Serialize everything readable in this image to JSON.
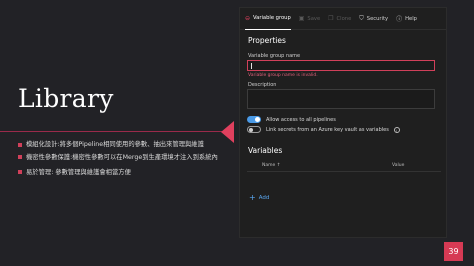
{
  "slide": {
    "title": "Library",
    "bullets": [
      "模組化設計:將多個Pipeline相同使用的參數、抽出來管理與維護",
      "機密性參數保護:機密性參數可以在Merge到生產環境才注入到系統內",
      "易於管理: 參數管理與維護會相當方便"
    ],
    "page_number": "39",
    "accent_color": "#d63a54"
  },
  "toolbar": {
    "variable_group": "Variable group",
    "save": "Save",
    "clone": "Clone",
    "security": "Security",
    "help": "Help"
  },
  "properties": {
    "title": "Properties",
    "name_label": "Variable group name",
    "name_value": "",
    "name_error": "Variable group name is invalid.",
    "description_label": "Description",
    "description_value": "",
    "allow_pipelines_label": "Allow access to all pipelines",
    "link_keyvault_label": "Link secrets from an Azure key vault as variables"
  },
  "variables": {
    "title": "Variables",
    "col_name": "Name ↑",
    "col_value": "Value",
    "add_label": "Add"
  },
  "icons": {
    "variable_group": "variable-group-icon",
    "save": "save-icon",
    "clone": "clone-icon",
    "security": "shield-icon",
    "help": "help-icon",
    "info": "info-icon",
    "add": "plus-icon"
  }
}
